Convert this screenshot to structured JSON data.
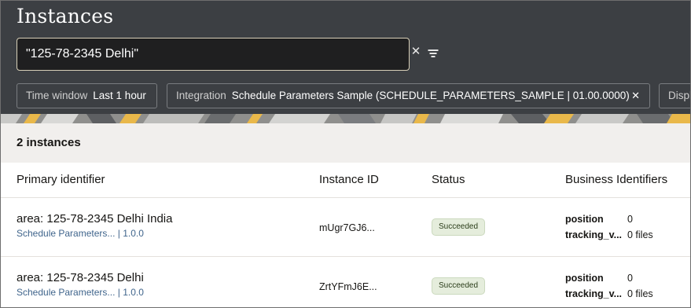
{
  "header": {
    "title": "Instances",
    "search": {
      "value": "\"125-78-2345 Delhi\""
    },
    "clear_icon": "close-icon",
    "filter_icon": "filter-icon",
    "chips": [
      {
        "key": "Time window",
        "value": "Last 1 hour"
      },
      {
        "key": "Integration",
        "value": "Schedule Parameters Sample (SCHEDULE_PARAMETERS_SAMPLE | 01.00.0000)",
        "close": "✕"
      },
      {
        "key": "Displ"
      }
    ]
  },
  "count_label": "2 instances",
  "columns": {
    "primary": "Primary identifier",
    "instance_id": "Instance ID",
    "status": "Status",
    "business": "Business Identifiers"
  },
  "rows": [
    {
      "primary": "area: 125-78-2345 Delhi India",
      "integration": "Schedule Parameters...",
      "version": "| 1.0.0",
      "instance_id": "mUgr7GJ6...",
      "status": "Succeeded",
      "bi": [
        {
          "key": "position",
          "value": "0"
        },
        {
          "key": "tracking_v...",
          "value": "0 files"
        }
      ]
    },
    {
      "primary": "area: 125-78-2345 Delhi",
      "integration": "Schedule Parameters...",
      "version": "| 1.0.0",
      "instance_id": "ZrtYFmJ6E...",
      "status": "Succeeded",
      "bi": [
        {
          "key": "position",
          "value": "0"
        },
        {
          "key": "tracking_v...",
          "value": "0 files"
        }
      ]
    }
  ],
  "colors": {
    "header_bg": "#3c3f43",
    "accent": "#40658c",
    "success_bg": "#e5eddc",
    "banner_yellow": "#e9b84a"
  }
}
